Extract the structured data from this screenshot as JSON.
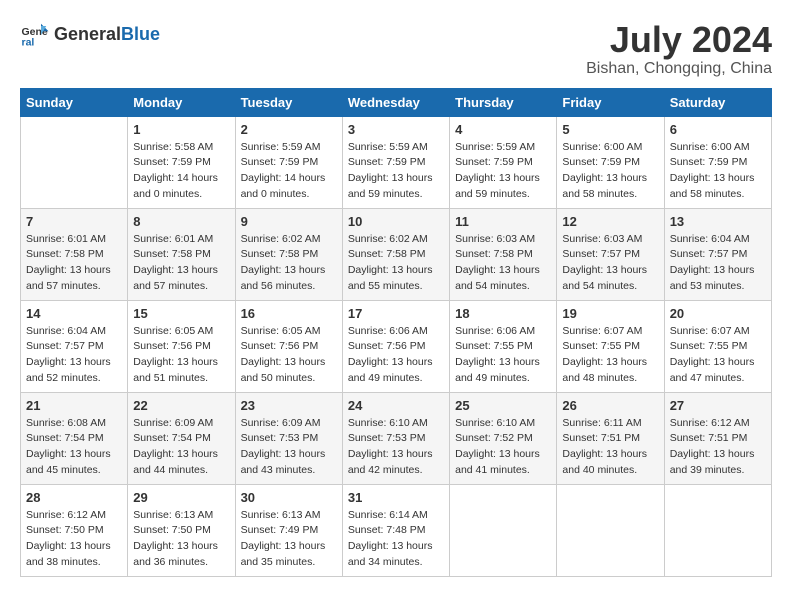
{
  "header": {
    "logo_line1": "General",
    "logo_line2": "Blue",
    "month_title": "July 2024",
    "location": "Bishan, Chongqing, China"
  },
  "days_of_week": [
    "Sunday",
    "Monday",
    "Tuesday",
    "Wednesday",
    "Thursday",
    "Friday",
    "Saturday"
  ],
  "weeks": [
    [
      {
        "day": "",
        "sunrise": "",
        "sunset": "",
        "daylight": ""
      },
      {
        "day": "1",
        "sunrise": "Sunrise: 5:58 AM",
        "sunset": "Sunset: 7:59 PM",
        "daylight": "Daylight: 14 hours and 0 minutes."
      },
      {
        "day": "2",
        "sunrise": "Sunrise: 5:59 AM",
        "sunset": "Sunset: 7:59 PM",
        "daylight": "Daylight: 14 hours and 0 minutes."
      },
      {
        "day": "3",
        "sunrise": "Sunrise: 5:59 AM",
        "sunset": "Sunset: 7:59 PM",
        "daylight": "Daylight: 13 hours and 59 minutes."
      },
      {
        "day": "4",
        "sunrise": "Sunrise: 5:59 AM",
        "sunset": "Sunset: 7:59 PM",
        "daylight": "Daylight: 13 hours and 59 minutes."
      },
      {
        "day": "5",
        "sunrise": "Sunrise: 6:00 AM",
        "sunset": "Sunset: 7:59 PM",
        "daylight": "Daylight: 13 hours and 58 minutes."
      },
      {
        "day": "6",
        "sunrise": "Sunrise: 6:00 AM",
        "sunset": "Sunset: 7:59 PM",
        "daylight": "Daylight: 13 hours and 58 minutes."
      }
    ],
    [
      {
        "day": "7",
        "sunrise": "Sunrise: 6:01 AM",
        "sunset": "Sunset: 7:58 PM",
        "daylight": "Daylight: 13 hours and 57 minutes."
      },
      {
        "day": "8",
        "sunrise": "Sunrise: 6:01 AM",
        "sunset": "Sunset: 7:58 PM",
        "daylight": "Daylight: 13 hours and 57 minutes."
      },
      {
        "day": "9",
        "sunrise": "Sunrise: 6:02 AM",
        "sunset": "Sunset: 7:58 PM",
        "daylight": "Daylight: 13 hours and 56 minutes."
      },
      {
        "day": "10",
        "sunrise": "Sunrise: 6:02 AM",
        "sunset": "Sunset: 7:58 PM",
        "daylight": "Daylight: 13 hours and 55 minutes."
      },
      {
        "day": "11",
        "sunrise": "Sunrise: 6:03 AM",
        "sunset": "Sunset: 7:58 PM",
        "daylight": "Daylight: 13 hours and 54 minutes."
      },
      {
        "day": "12",
        "sunrise": "Sunrise: 6:03 AM",
        "sunset": "Sunset: 7:57 PM",
        "daylight": "Daylight: 13 hours and 54 minutes."
      },
      {
        "day": "13",
        "sunrise": "Sunrise: 6:04 AM",
        "sunset": "Sunset: 7:57 PM",
        "daylight": "Daylight: 13 hours and 53 minutes."
      }
    ],
    [
      {
        "day": "14",
        "sunrise": "Sunrise: 6:04 AM",
        "sunset": "Sunset: 7:57 PM",
        "daylight": "Daylight: 13 hours and 52 minutes."
      },
      {
        "day": "15",
        "sunrise": "Sunrise: 6:05 AM",
        "sunset": "Sunset: 7:56 PM",
        "daylight": "Daylight: 13 hours and 51 minutes."
      },
      {
        "day": "16",
        "sunrise": "Sunrise: 6:05 AM",
        "sunset": "Sunset: 7:56 PM",
        "daylight": "Daylight: 13 hours and 50 minutes."
      },
      {
        "day": "17",
        "sunrise": "Sunrise: 6:06 AM",
        "sunset": "Sunset: 7:56 PM",
        "daylight": "Daylight: 13 hours and 49 minutes."
      },
      {
        "day": "18",
        "sunrise": "Sunrise: 6:06 AM",
        "sunset": "Sunset: 7:55 PM",
        "daylight": "Daylight: 13 hours and 49 minutes."
      },
      {
        "day": "19",
        "sunrise": "Sunrise: 6:07 AM",
        "sunset": "Sunset: 7:55 PM",
        "daylight": "Daylight: 13 hours and 48 minutes."
      },
      {
        "day": "20",
        "sunrise": "Sunrise: 6:07 AM",
        "sunset": "Sunset: 7:55 PM",
        "daylight": "Daylight: 13 hours and 47 minutes."
      }
    ],
    [
      {
        "day": "21",
        "sunrise": "Sunrise: 6:08 AM",
        "sunset": "Sunset: 7:54 PM",
        "daylight": "Daylight: 13 hours and 45 minutes."
      },
      {
        "day": "22",
        "sunrise": "Sunrise: 6:09 AM",
        "sunset": "Sunset: 7:54 PM",
        "daylight": "Daylight: 13 hours and 44 minutes."
      },
      {
        "day": "23",
        "sunrise": "Sunrise: 6:09 AM",
        "sunset": "Sunset: 7:53 PM",
        "daylight": "Daylight: 13 hours and 43 minutes."
      },
      {
        "day": "24",
        "sunrise": "Sunrise: 6:10 AM",
        "sunset": "Sunset: 7:53 PM",
        "daylight": "Daylight: 13 hours and 42 minutes."
      },
      {
        "day": "25",
        "sunrise": "Sunrise: 6:10 AM",
        "sunset": "Sunset: 7:52 PM",
        "daylight": "Daylight: 13 hours and 41 minutes."
      },
      {
        "day": "26",
        "sunrise": "Sunrise: 6:11 AM",
        "sunset": "Sunset: 7:51 PM",
        "daylight": "Daylight: 13 hours and 40 minutes."
      },
      {
        "day": "27",
        "sunrise": "Sunrise: 6:12 AM",
        "sunset": "Sunset: 7:51 PM",
        "daylight": "Daylight: 13 hours and 39 minutes."
      }
    ],
    [
      {
        "day": "28",
        "sunrise": "Sunrise: 6:12 AM",
        "sunset": "Sunset: 7:50 PM",
        "daylight": "Daylight: 13 hours and 38 minutes."
      },
      {
        "day": "29",
        "sunrise": "Sunrise: 6:13 AM",
        "sunset": "Sunset: 7:50 PM",
        "daylight": "Daylight: 13 hours and 36 minutes."
      },
      {
        "day": "30",
        "sunrise": "Sunrise: 6:13 AM",
        "sunset": "Sunset: 7:49 PM",
        "daylight": "Daylight: 13 hours and 35 minutes."
      },
      {
        "day": "31",
        "sunrise": "Sunrise: 6:14 AM",
        "sunset": "Sunset: 7:48 PM",
        "daylight": "Daylight: 13 hours and 34 minutes."
      },
      {
        "day": "",
        "sunrise": "",
        "sunset": "",
        "daylight": ""
      },
      {
        "day": "",
        "sunrise": "",
        "sunset": "",
        "daylight": ""
      },
      {
        "day": "",
        "sunrise": "",
        "sunset": "",
        "daylight": ""
      }
    ]
  ]
}
